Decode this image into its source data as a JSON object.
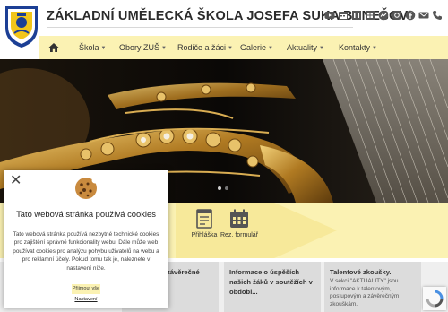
{
  "header": {
    "title": "ZÁKLADNÍ UMĚLECKÁ ŠKOLA JOSEFA SUKA BENEŠOV",
    "social_icons": [
      "youtube-icon",
      "calendar-icon",
      "office-icon",
      "grid-icon",
      "messenger-icon",
      "instagram-icon",
      "facebook-icon",
      "email-icon",
      "phone-icon"
    ]
  },
  "nav": {
    "items": [
      {
        "label": "Škola",
        "dropdown": true
      },
      {
        "label": "Obory ZUŠ",
        "dropdown": true
      },
      {
        "label": "Rodiče a žáci",
        "dropdown": true
      },
      {
        "label": "Galerie",
        "dropdown": true
      },
      {
        "label": "Aktuality",
        "dropdown": true
      },
      {
        "label": "Kontakty",
        "dropdown": true
      }
    ]
  },
  "quick_links": [
    {
      "label": "Přihláška",
      "icon": "application-form-icon"
    },
    {
      "label": "Rez. formulář",
      "icon": "calendar-icon"
    }
  ],
  "cards": [
    {
      "title": "závěrečné",
      "text": ""
    },
    {
      "title": "Informace o úspěších našich žáků v soutěžích v obdobi...",
      "text": ""
    },
    {
      "title": "Talentové zkoušky.",
      "text": "V sekci \"AKTUALITY\" jsou informace k talentovým, postupovým a závěrečným zkouškám."
    }
  ],
  "cookie": {
    "title": "Tato webová stránka používá cookies",
    "text": "Tato webová stránka používá nezbytné technické cookies pro zajištění správné funkcionality webu. Dále může web používat cookies pro analýzu pohybu uživatelů na webu a pro reklamní účely. Pokud tomu tak je, naleznete v nastavení níže.",
    "accept_label": "Přijmout vše",
    "settings_label": "Nastavení"
  },
  "colors": {
    "accent_yellow": "#fbf2b3",
    "tile_yellow": "#f7e99a",
    "logo_blue": "#1c3f95"
  }
}
